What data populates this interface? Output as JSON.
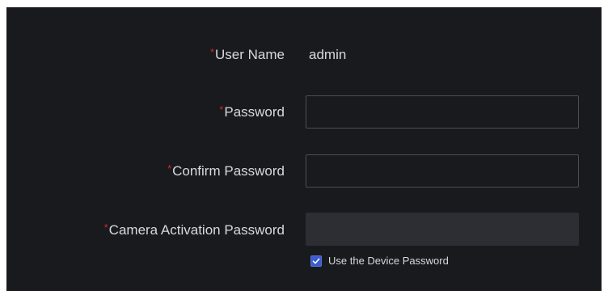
{
  "form": {
    "username": {
      "label": "User Name",
      "required_mark": "*",
      "value": "admin"
    },
    "password": {
      "label": "Password",
      "required_mark": "*",
      "value": ""
    },
    "confirm_password": {
      "label": "Confirm Password",
      "required_mark": "*",
      "value": ""
    },
    "camera_activation_password": {
      "label": "Camera Activation Password",
      "required_mark": "*",
      "value": "",
      "disabled": true
    },
    "use_device_password": {
      "label": "Use the Device Password",
      "checked": true
    }
  },
  "colors": {
    "panel_bg": "#181a1e",
    "text": "#d7d9de",
    "required": "#d2262b",
    "field_border": "#4b4e55",
    "disabled_field": "#2c2e33",
    "checkbox_accent": "#3b5bd1"
  }
}
